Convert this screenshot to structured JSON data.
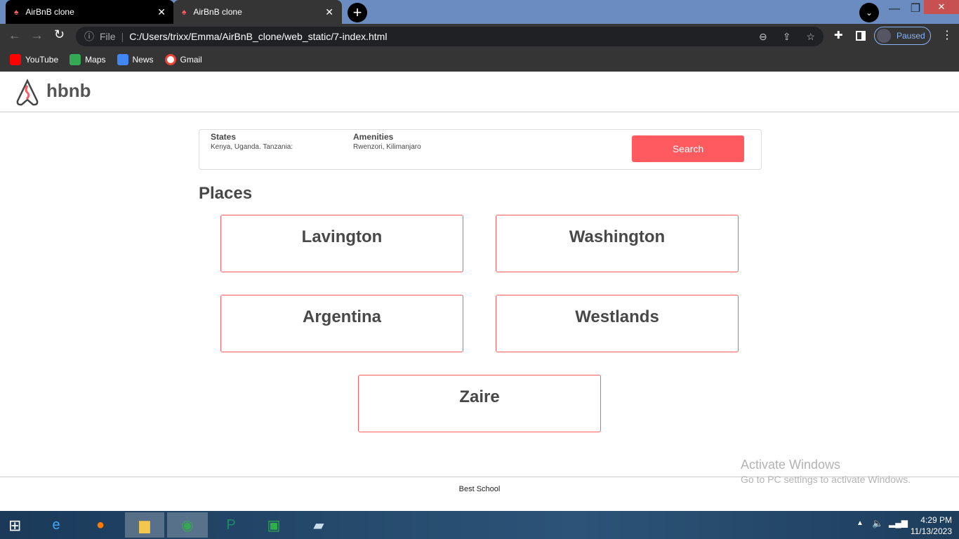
{
  "browser": {
    "tabs": [
      {
        "title": "AirBnB clone"
      },
      {
        "title": "AirBnB clone"
      }
    ],
    "address_prefix": "File",
    "url": "C:/Users/trixx/Emma/AirBnB_clone/web_static/7-index.html",
    "profile_status": "Paused",
    "bookmarks": [
      {
        "label": "YouTube",
        "color": "#ff0000"
      },
      {
        "label": "Maps",
        "color": "#34a853"
      },
      {
        "label": "News",
        "color": "#4285f4"
      },
      {
        "label": "Gmail",
        "color": "#ea4335"
      }
    ]
  },
  "header": {
    "logo_text": "hbnb"
  },
  "filters": {
    "states_label": "States",
    "states_value": "Kenya, Uganda. Tanzania:",
    "amenities_label": "Amenities",
    "amenities_value": "Rwenzori, Kilimanjaro",
    "search_label": "Search"
  },
  "places": {
    "title": "Places",
    "items": [
      "Lavington",
      "Washington",
      "Argentina",
      "Westlands",
      "Zaire"
    ]
  },
  "footer": {
    "text": "Best School"
  },
  "watermark": {
    "title": "Activate Windows",
    "subtitle": "Go to PC settings to activate Windows."
  },
  "taskbar": {
    "time": "4:29 PM",
    "date": "11/13/2023"
  },
  "colors": {
    "accent": "#ff5a5f"
  }
}
